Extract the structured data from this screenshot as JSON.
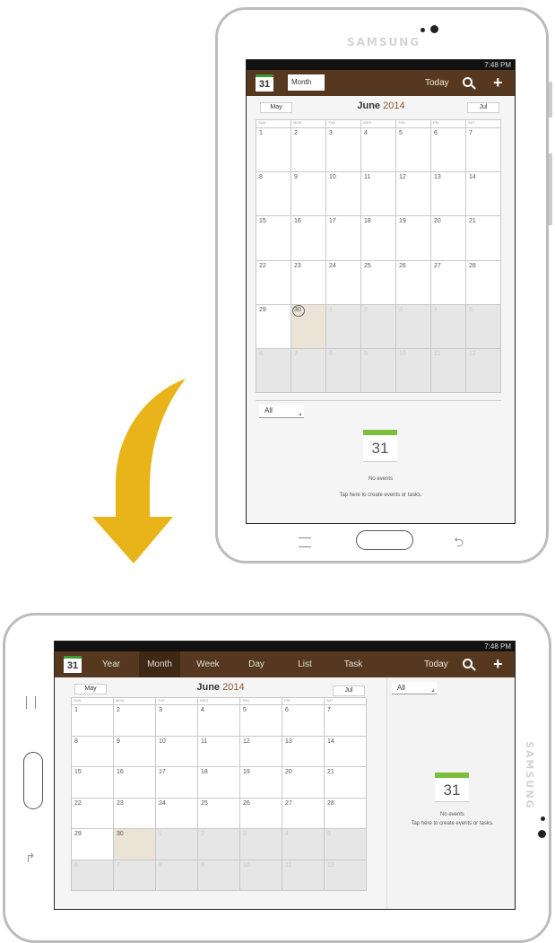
{
  "device": {
    "brand": "SAMSUNG"
  },
  "status_bar": {
    "time": "7:48 PM",
    "indicators": "4G LTE signal battery"
  },
  "app": {
    "icon_day": "31",
    "view_selector": "Month",
    "today_label": "Today"
  },
  "tabs": [
    "Year",
    "Month",
    "Week",
    "Day",
    "List",
    "Task"
  ],
  "active_tab": "Month",
  "calendar": {
    "month": "June",
    "year": "2014",
    "prev_label": "May",
    "next_label": "Jul",
    "weekdays": [
      "SUN",
      "MON",
      "TUE",
      "WED",
      "THU",
      "FRI",
      "SAT"
    ],
    "weeks": [
      [
        "1",
        "2",
        "3",
        "4",
        "5",
        "6",
        "7"
      ],
      [
        "8",
        "9",
        "10",
        "11",
        "12",
        "13",
        "14"
      ],
      [
        "15",
        "16",
        "17",
        "18",
        "19",
        "20",
        "21"
      ],
      [
        "22",
        "23",
        "24",
        "25",
        "26",
        "27",
        "28"
      ],
      [
        "29",
        "30",
        "1",
        "2",
        "3",
        "4",
        "5"
      ],
      [
        "6",
        "7",
        "8",
        "9",
        "10",
        "11",
        "12"
      ]
    ],
    "today": "30"
  },
  "events_panel": {
    "filter": "All",
    "day": "31",
    "no_events": "No events",
    "hint": "Tap here to create events or tasks."
  },
  "colors": {
    "action_bar": "#55381f",
    "arrow": "#e8b419",
    "icon_green": "#3d9b35"
  }
}
